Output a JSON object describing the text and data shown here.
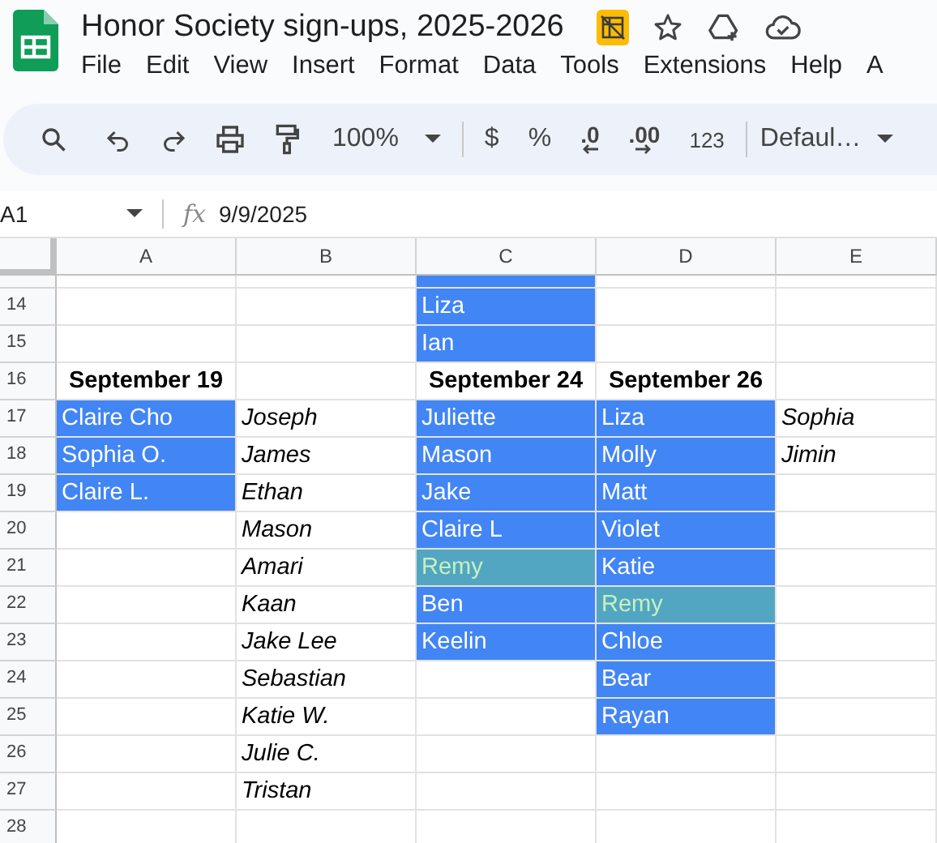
{
  "document": {
    "title": "Honor Society sign-ups, 2025-2026"
  },
  "menu": [
    "File",
    "Edit",
    "View",
    "Insert",
    "Format",
    "Data",
    "Tools",
    "Extensions",
    "Help",
    "A"
  ],
  "toolbar": {
    "zoom": "100%",
    "currency": "$",
    "percent": "%",
    "decrease_decimals": ".0",
    "increase_decimals": ".00",
    "number_format": "123",
    "font": "Defaul…"
  },
  "formula_bar": {
    "cell": "A1",
    "function_label": "fx",
    "value": "9/9/2025"
  },
  "columns": [
    "A",
    "B",
    "C",
    "D",
    "E"
  ],
  "partial_row": {
    "cells": [
      {},
      {},
      {
        "color": "#4285f4"
      },
      {},
      {}
    ]
  },
  "rows": [
    {
      "number": "14",
      "cells": [
        {},
        {},
        {
          "text": "Liza",
          "color": "#4285f4"
        },
        {},
        {}
      ]
    },
    {
      "number": "15",
      "cells": [
        {},
        {},
        {
          "text": "Ian",
          "color": "#4285f4"
        },
        {},
        {}
      ]
    },
    {
      "number": "16",
      "cells": [
        {
          "text": "September 19",
          "kind": "heading"
        },
        {},
        {
          "text": "September 24",
          "kind": "heading"
        },
        {
          "text": "September 26",
          "kind": "heading"
        },
        {}
      ]
    },
    {
      "number": "17",
      "cells": [
        {
          "text": "Claire Cho",
          "color": "#4285f4"
        },
        {
          "text": "Joseph",
          "kind": "italic"
        },
        {
          "text": "Juliette",
          "color": "#4285f4"
        },
        {
          "text": "Liza",
          "color": "#4285f4"
        },
        {
          "text": "Sophia",
          "kind": "italic"
        }
      ]
    },
    {
      "number": "18",
      "cells": [
        {
          "text": "Sophia O.",
          "color": "#4285f4"
        },
        {
          "text": "James",
          "kind": "italic"
        },
        {
          "text": "Mason",
          "color": "#4285f4"
        },
        {
          "text": "Molly",
          "color": "#4285f4"
        },
        {
          "text": "Jimin",
          "kind": "italic"
        }
      ]
    },
    {
      "number": "19",
      "cells": [
        {
          "text": "Claire L.",
          "color": "#4285f4"
        },
        {
          "text": "Ethan",
          "kind": "italic"
        },
        {
          "text": "Jake",
          "color": "#4285f4"
        },
        {
          "text": "Matt",
          "color": "#4285f4"
        },
        {}
      ]
    },
    {
      "number": "20",
      "cells": [
        {},
        {
          "text": "Mason",
          "kind": "italic"
        },
        {
          "text": "Claire L",
          "color": "#4285f4"
        },
        {
          "text": "Violet",
          "color": "#4285f4"
        },
        {}
      ]
    },
    {
      "number": "21",
      "cells": [
        {},
        {
          "text": "Amari",
          "kind": "italic"
        },
        {
          "text": "Remy",
          "color": "#53a6c2"
        },
        {
          "text": "Katie",
          "color": "#4285f4"
        },
        {}
      ]
    },
    {
      "number": "22",
      "cells": [
        {},
        {
          "text": "Kaan",
          "kind": "italic"
        },
        {
          "text": "Ben",
          "color": "#4285f4"
        },
        {
          "text": "Remy",
          "color": "#53a6c2"
        },
        {}
      ]
    },
    {
      "number": "23",
      "cells": [
        {},
        {
          "text": "Jake Lee",
          "kind": "italic"
        },
        {
          "text": "Keelin",
          "color": "#4285f4"
        },
        {
          "text": "Chloe",
          "color": "#4285f4"
        },
        {}
      ]
    },
    {
      "number": "24",
      "cells": [
        {},
        {
          "text": "Sebastian",
          "kind": "italic"
        },
        {},
        {
          "text": "Bear",
          "color": "#4285f4"
        },
        {}
      ]
    },
    {
      "number": "25",
      "cells": [
        {},
        {
          "text": "Katie W.",
          "kind": "italic"
        },
        {},
        {
          "text": "Rayan",
          "color": "#4285f4"
        },
        {}
      ]
    },
    {
      "number": "26",
      "cells": [
        {},
        {
          "text": "Julie C.",
          "kind": "italic"
        },
        {},
        {},
        {}
      ]
    },
    {
      "number": "27",
      "cells": [
        {},
        {
          "text": "Tristan",
          "kind": "italic"
        },
        {},
        {},
        {}
      ]
    },
    {
      "number": "28",
      "cells": [
        {},
        {},
        {},
        {},
        {}
      ]
    }
  ]
}
